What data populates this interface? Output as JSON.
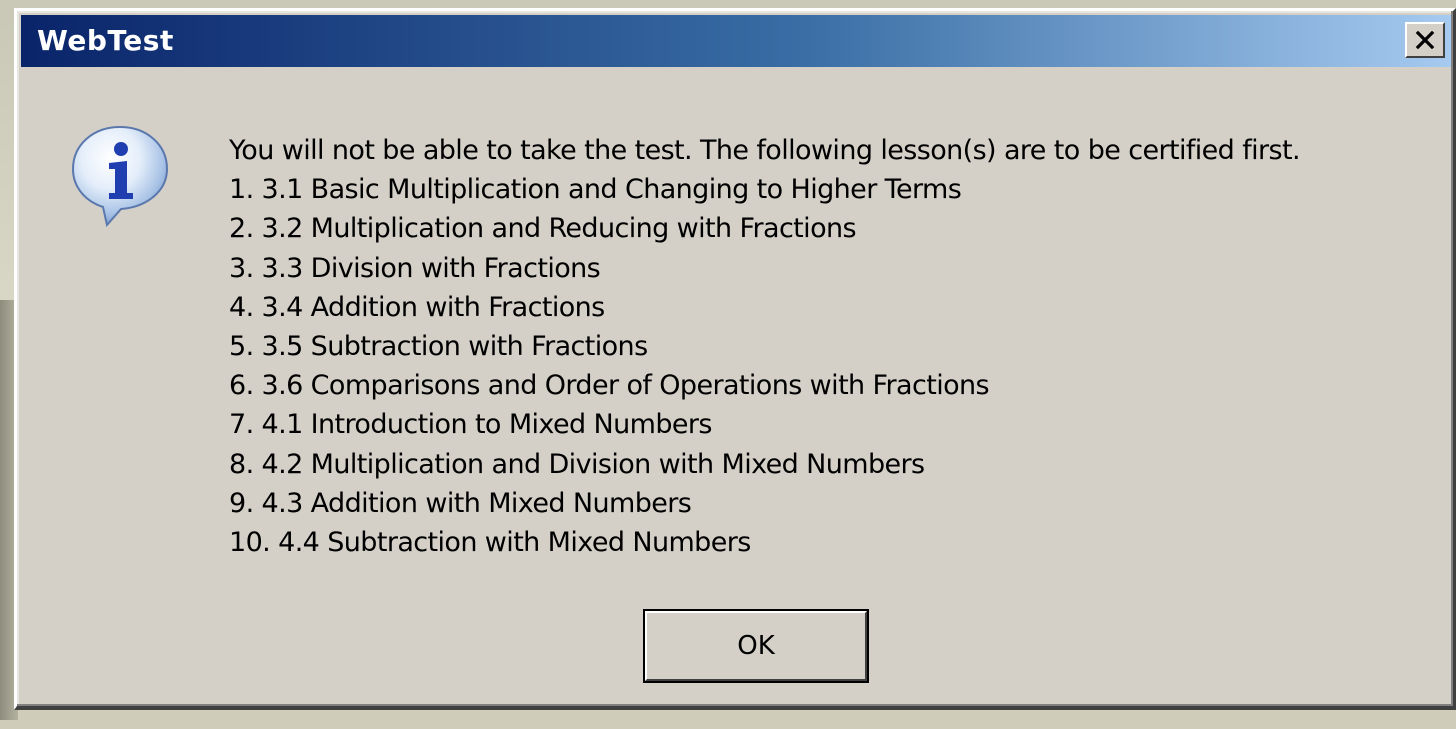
{
  "window": {
    "title": "WebTest"
  },
  "icons": {
    "info": "info-icon",
    "close": "close-icon"
  },
  "message": {
    "intro": "You will not be able to take the test. The following lesson(s) are to be certified first.",
    "lessons": [
      "1. 3.1 Basic Multiplication and Changing to Higher Terms",
      "2. 3.2 Multiplication and Reducing with Fractions",
      "3. 3.3 Division with Fractions",
      "4. 3.4 Addition with Fractions",
      "5. 3.5 Subtraction with Fractions",
      "6. 3.6 Comparisons and Order of Operations with Fractions",
      "7. 4.1 Introduction to Mixed Numbers",
      "8. 4.2 Multiplication and Division with Mixed Numbers",
      "9. 4.3 Addition with Mixed Numbers",
      "10. 4.4 Subtraction with Mixed Numbers"
    ]
  },
  "buttons": {
    "ok_label": "OK"
  },
  "colors": {
    "titlebar_start": "#0a246a",
    "titlebar_end": "#a6caf0",
    "dialog_face": "#d4d0c8"
  }
}
